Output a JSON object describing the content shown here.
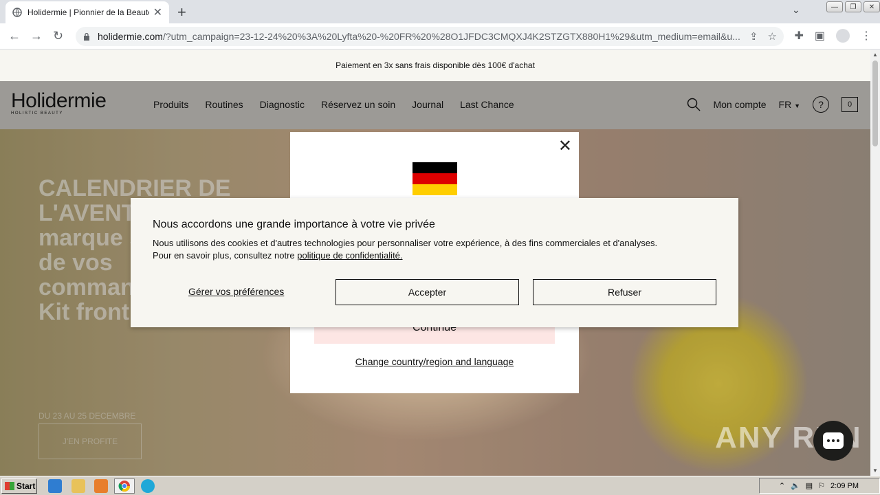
{
  "browser": {
    "tab_title": "Holidermie | Pionnier de la Beauté Holistique",
    "tab_close": "✕",
    "new_tab": "+",
    "url_domain": "holidermie.com",
    "url_rest": "/?utm_campaign=23-12-24%20%3A%20Lyfta%20-%20FR%20%28O1JFDC3CMQXJ4K2STZGTX880H1%29&utm_medium=email&u..."
  },
  "promo": {
    "text": "Paiement en 3x sans frais disponible dès 100€ d'achat"
  },
  "header": {
    "brand": "Holidermie",
    "brand_sub": "HOLISTIC BEAUTY",
    "nav": [
      "Produits",
      "Routines",
      "Diagnostic",
      "Réservez un soin",
      "Journal",
      "Last Chance"
    ],
    "account": "Mon compte",
    "language": "FR",
    "help": "?",
    "cart_count": "0"
  },
  "hero": {
    "headline": "CALENDRIER DE L'AVENT La marque se glisse de vos commandes : Le Kit front & yeux",
    "date": "DU 23 AU 25 DECEMBRE",
    "cta": "J'EN PROFITE"
  },
  "country_modal": {
    "close": "✕",
    "continue": "Continue",
    "change": "Change country/region and language",
    "flag_colors": [
      "#000000",
      "#dd0000",
      "#ffce00"
    ]
  },
  "cookie": {
    "title": "Nous accordons une grande importance à votre vie privée",
    "text_1": "Nous utilisons des cookies et d'autres technologies pour personnaliser votre expérience, à des fins commerciales et d'analyses.",
    "text_2": "Pour en savoir plus, consultez notre",
    "link": "politique de confidentialité.",
    "preferences": "Gérer vos préférences",
    "accept": "Accepter",
    "refuse": "Refuser"
  },
  "watermark": "ANY RUN",
  "taskbar": {
    "start": "Start",
    "time": "2:09 PM"
  }
}
